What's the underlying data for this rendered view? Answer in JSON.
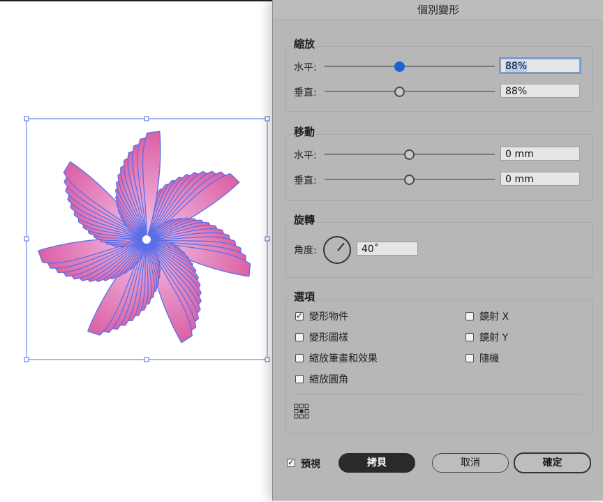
{
  "dialog": {
    "title": "個別變形",
    "scale": {
      "title": "縮放",
      "horizontal": {
        "label": "水平:",
        "value": "88%"
      },
      "vertical": {
        "label": "垂直:",
        "value": "88%"
      }
    },
    "move": {
      "title": "移動",
      "horizontal": {
        "label": "水平:",
        "value": "0 mm"
      },
      "vertical": {
        "label": "垂直:",
        "value": "0 mm"
      }
    },
    "rotate": {
      "title": "旋轉",
      "angle_label": "角度:",
      "angle_value": "40˚"
    },
    "options": {
      "title": "選項",
      "transform_objects": {
        "label": "變形物件",
        "checked": true
      },
      "transform_patterns": {
        "label": "變形圖樣",
        "checked": false
      },
      "scale_strokes": {
        "label": "縮放筆畫和效果",
        "checked": false
      },
      "scale_corners": {
        "label": "縮放圓角",
        "checked": false
      },
      "reflect_x": {
        "label": "鏡射 X",
        "checked": false
      },
      "reflect_y": {
        "label": "鏡射 Y",
        "checked": false
      },
      "random": {
        "label": "隨機",
        "checked": false
      }
    },
    "footer": {
      "preview": {
        "label": "預視",
        "checked": true
      },
      "copy_label": "拷貝",
      "cancel_label": "取消",
      "ok_label": "確定"
    }
  },
  "colors": {
    "selection": "#4b6fe0",
    "art_fill_outer": "#e06aa8",
    "art_fill_inner": "#efc0e6",
    "art_stroke": "#5a6ee8",
    "slider_active": "#1b63d4"
  }
}
